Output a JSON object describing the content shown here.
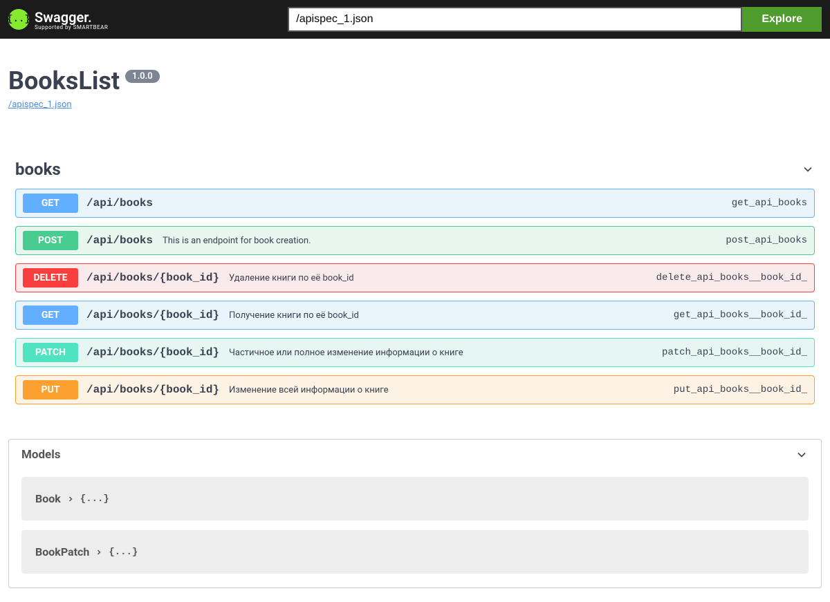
{
  "topbar": {
    "logo_text": "Swagger.",
    "logo_sub": "Supported by SMARTBEAR",
    "search_value": "/apispec_1.json",
    "explore_label": "Explore"
  },
  "header": {
    "title": "BooksList",
    "version": "1.0.0",
    "spec_link": "/apispec_1.json"
  },
  "section": {
    "name": "books"
  },
  "operations": [
    {
      "method": "GET",
      "cls": "get",
      "path": "/api/books",
      "desc": "",
      "opid": "get_api_books"
    },
    {
      "method": "POST",
      "cls": "post",
      "path": "/api/books",
      "desc": "This is an endpoint for book creation.",
      "opid": "post_api_books"
    },
    {
      "method": "DELETE",
      "cls": "delete",
      "path": "/api/books/{book_id}",
      "desc": "Удаление книги по её book_id",
      "opid": "delete_api_books__book_id_"
    },
    {
      "method": "GET",
      "cls": "get",
      "path": "/api/books/{book_id}",
      "desc": "Получение книги по её book_id",
      "opid": "get_api_books__book_id_"
    },
    {
      "method": "PATCH",
      "cls": "patch",
      "path": "/api/books/{book_id}",
      "desc": "Частичное или полное изменение информации о книге",
      "opid": "patch_api_books__book_id_"
    },
    {
      "method": "PUT",
      "cls": "put",
      "path": "/api/books/{book_id}",
      "desc": "Изменение всей информации о книге",
      "opid": "put_api_books__book_id_"
    }
  ],
  "models": {
    "title": "Models",
    "items": [
      {
        "name": "Book",
        "brace": "{...}"
      },
      {
        "name": "BookPatch",
        "brace": "{...}"
      }
    ]
  }
}
